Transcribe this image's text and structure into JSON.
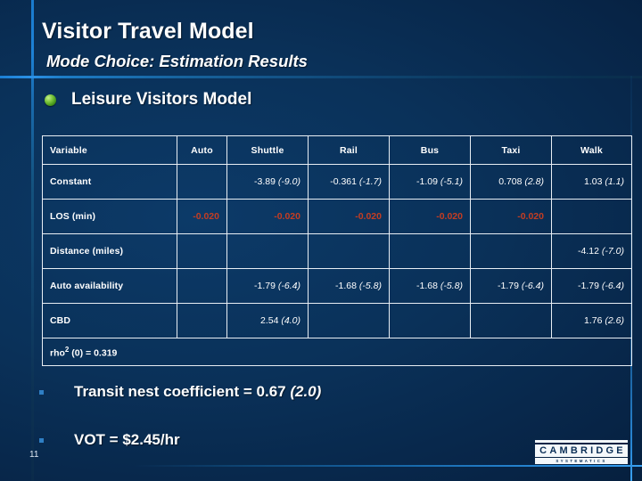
{
  "slide": {
    "title": "Visitor Travel Model",
    "subtitle": "Mode Choice: Estimation Results",
    "section_bullet": "Leisure Visitors Model",
    "page_number": "11"
  },
  "table": {
    "headers": [
      "Variable",
      "Auto",
      "Shuttle",
      "Rail",
      "Bus",
      "Taxi",
      "Walk"
    ],
    "rows": [
      {
        "variable": "Constant",
        "cells": [
          "",
          "-3.89 (-9.0)",
          "-0.361 (-1.7)",
          "-1.09 (-5.1)",
          "0.708 (2.8)",
          "1.03 (1.1)"
        ],
        "style": "normal"
      },
      {
        "variable": "LOS (min)",
        "cells": [
          "-0.020",
          "-0.020",
          "-0.020",
          "-0.020",
          "-0.020",
          ""
        ],
        "style": "red"
      },
      {
        "variable": "Distance (miles)",
        "cells": [
          "",
          "",
          "",
          "",
          "",
          "-4.12 (-7.0)"
        ],
        "style": "normal"
      },
      {
        "variable": "Auto availability",
        "cells": [
          "",
          "-1.79 (-6.4)",
          "-1.68 (-5.8)",
          "-1.68 (-5.8)",
          "-1.79 (-6.4)",
          "-1.79 (-6.4)"
        ],
        "style": "normal"
      },
      {
        "variable": "CBD",
        "cells": [
          "",
          "2.54 (4.0)",
          "",
          "",
          "",
          "1.76 (2.6)"
        ],
        "style": "normal"
      }
    ],
    "footer_label_prefix": "rho",
    "footer_label_sup": "2",
    "footer_label_suffix": " (0) = 0.319"
  },
  "bullets": [
    {
      "text_plain": "Transit nest coefficient = 0.67 ",
      "text_italic": "(2.0)"
    },
    {
      "text_plain": "VOT = $2.45/hr",
      "text_italic": ""
    }
  ],
  "logo": {
    "word": "CAMBRIDGE",
    "sub": "SYSTEMATICS"
  },
  "colors": {
    "background_navy": "#0a3159",
    "accent_blue": "#1b7fd4",
    "red_value": "#c43d22",
    "bullet_green": "#79c43a",
    "text_white": "#ffffff"
  }
}
